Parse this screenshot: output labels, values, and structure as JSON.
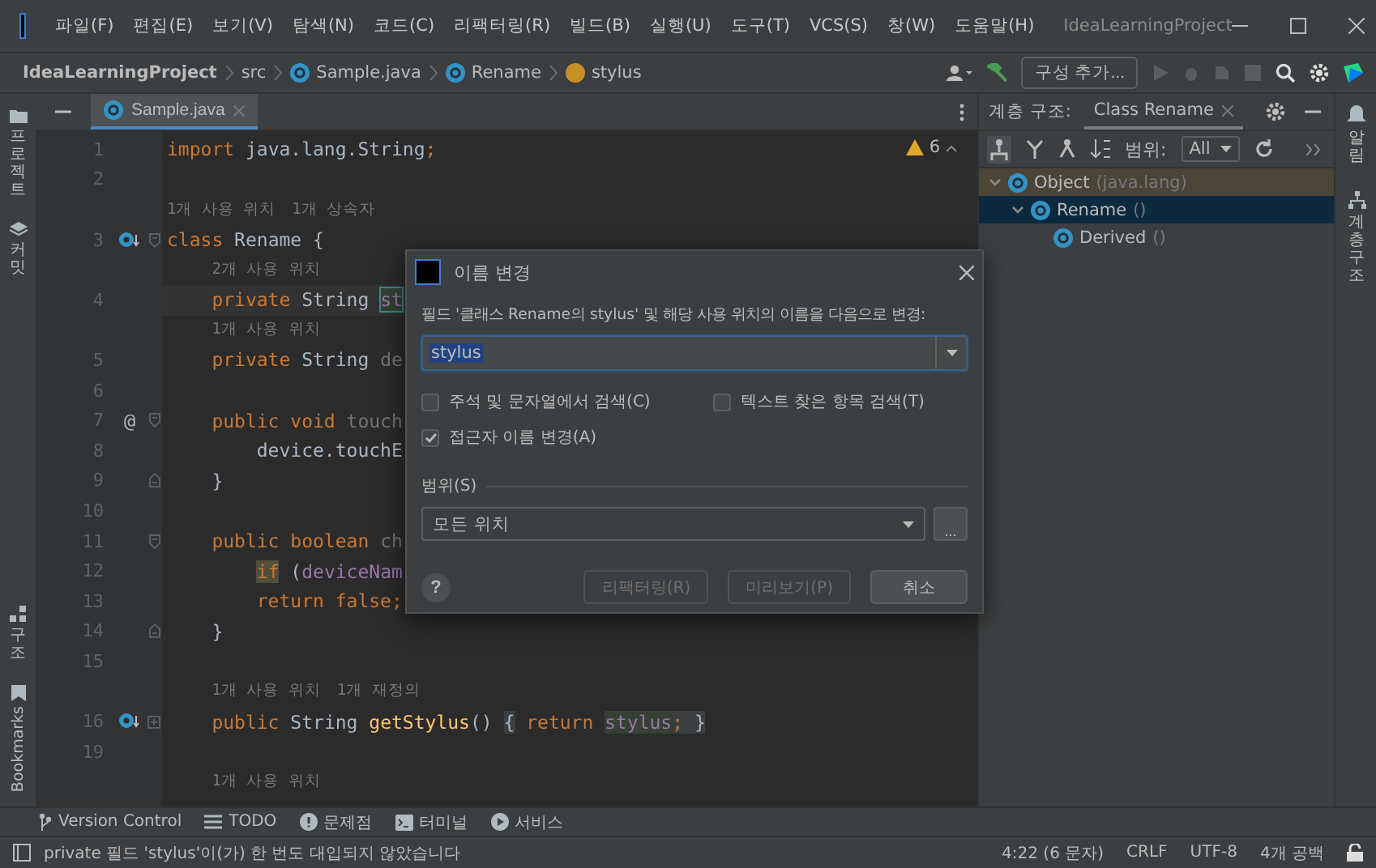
{
  "title_bar": {
    "menu": [
      "파일(F)",
      "편집(E)",
      "보기(V)",
      "탐색(N)",
      "코드(C)",
      "리팩터링(R)",
      "빌드(B)",
      "실행(U)",
      "도구(T)",
      "VCS(S)",
      "창(W)",
      "도움말(H)"
    ],
    "project": "IdeaLearningProject"
  },
  "nav_bar": {
    "breadcrumbs": [
      {
        "label": "IdeaLearningProject",
        "kind": "project"
      },
      {
        "label": "src",
        "kind": "folder"
      },
      {
        "label": "Sample.java",
        "kind": "class"
      },
      {
        "label": "Rename",
        "kind": "class"
      },
      {
        "label": "stylus",
        "kind": "field"
      }
    ],
    "run_config": "구성 추가..."
  },
  "left_strip": {
    "top": [
      {
        "label": "프로젝트",
        "kind": "folder"
      },
      {
        "label": "커밋",
        "kind": "commit"
      }
    ],
    "bottom": [
      {
        "label": "구조",
        "kind": "structure"
      },
      {
        "label": "Bookmarks",
        "kind": "bookmark"
      }
    ]
  },
  "editor": {
    "tabs": [
      {
        "label": "Sample.java",
        "selected": true
      }
    ],
    "inspection_count": "6",
    "rows": [
      {
        "kind": "code",
        "number": "1",
        "current": false,
        "tokens": [
          {
            "text": "import ",
            "kind": "keyword"
          },
          {
            "text": "java.lang.String",
            "kind": "plain"
          },
          {
            "text": ";",
            "kind": "keyword"
          }
        ]
      },
      {
        "kind": "code",
        "number": "2",
        "current": false,
        "tokens": []
      },
      {
        "kind": "hint",
        "indent": "",
        "items": [
          "1개 사용 위치",
          "1개 상속자"
        ]
      },
      {
        "kind": "code",
        "number": "3",
        "current": false,
        "gutter_icon": {
          "kind": "override"
        },
        "fold_mark": {
          "kind": "start"
        },
        "tokens": [
          {
            "text": "class ",
            "kind": "keyword"
          },
          {
            "text": "Rename {",
            "kind": "plain"
          }
        ]
      },
      {
        "kind": "hint",
        "indent": "    ",
        "items": [
          "2개 사용 위치"
        ]
      },
      {
        "kind": "code",
        "number": "4",
        "current": true,
        "tokens": [
          {
            "text": "    private ",
            "kind": "keyword"
          },
          {
            "text": "String ",
            "kind": "plain"
          },
          {
            "text": "st",
            "kind": "field",
            "highlight": {
              "kind": "usage"
            }
          }
        ]
      },
      {
        "kind": "hint",
        "indent": "    ",
        "items": [
          "1개 사용 위치"
        ]
      },
      {
        "kind": "code",
        "number": "5",
        "current": false,
        "tokens": [
          {
            "text": "    private ",
            "kind": "keyword"
          },
          {
            "text": "String ",
            "kind": "plain"
          },
          {
            "text": "de",
            "kind": "unused"
          }
        ]
      },
      {
        "kind": "code",
        "number": "6",
        "current": false,
        "tokens": []
      },
      {
        "kind": "code",
        "number": "7",
        "current": false,
        "gutter_text": "@",
        "fold_mark": {
          "kind": "start"
        },
        "tokens": [
          {
            "text": "    public void ",
            "kind": "keyword"
          },
          {
            "text": "touch",
            "kind": "unused"
          }
        ]
      },
      {
        "kind": "code",
        "number": "8",
        "current": false,
        "tokens": [
          {
            "text": "        device.touchE",
            "kind": "plain"
          }
        ]
      },
      {
        "kind": "code",
        "number": "9",
        "current": false,
        "fold_mark": {
          "kind": "end"
        },
        "tokens": [
          {
            "text": "    }",
            "kind": "plain"
          }
        ]
      },
      {
        "kind": "code",
        "number": "10",
        "current": false,
        "tokens": []
      },
      {
        "kind": "code",
        "number": "11",
        "current": false,
        "fold_mark": {
          "kind": "start"
        },
        "tokens": [
          {
            "text": "    public boolean ",
            "kind": "keyword"
          },
          {
            "text": "ch",
            "kind": "unused"
          }
        ]
      },
      {
        "kind": "code",
        "number": "12",
        "current": false,
        "indent": "        ",
        "tokens": [
          {
            "text": "if",
            "kind": "keyword",
            "highlight": {
              "kind": "warning"
            }
          },
          {
            "text": " (",
            "kind": "plain"
          },
          {
            "text": "deviceNam",
            "kind": "field"
          }
        ]
      },
      {
        "kind": "code",
        "number": "13",
        "current": false,
        "tokens": [
          {
            "text": "        return false;",
            "kind": "keyword"
          }
        ]
      },
      {
        "kind": "code",
        "number": "14",
        "current": false,
        "fold_mark": {
          "kind": "end"
        },
        "tokens": [
          {
            "text": "    }",
            "kind": "plain"
          }
        ]
      },
      {
        "kind": "code",
        "number": "15",
        "current": false,
        "tokens": []
      },
      {
        "kind": "hint",
        "indent": "    ",
        "items": [
          "1개 사용 위치",
          "1개 재정의"
        ]
      },
      {
        "kind": "code",
        "number": "16",
        "current": false,
        "gutter_icon": {
          "kind": "override"
        },
        "fold_mark": {
          "kind": "collapsed"
        },
        "tokens": [
          {
            "text": "    public ",
            "kind": "keyword"
          },
          {
            "text": "String ",
            "kind": "plain"
          },
          {
            "text": "getStylus",
            "kind": "method"
          },
          {
            "text": "() ",
            "kind": "plain"
          },
          {
            "text": "{",
            "kind": "plain",
            "highlight": {
              "kind": "brace"
            }
          },
          {
            "text": " return ",
            "kind": "keyword"
          },
          {
            "text": "stylus",
            "kind": "field",
            "highlight": {
              "kind": "write"
            }
          },
          {
            "text": "; ",
            "kind": "keyword",
            "highlight": {
              "kind": "brace"
            }
          },
          {
            "text": "}",
            "kind": "plain",
            "highlight": {
              "kind": "brace"
            }
          }
        ]
      },
      {
        "kind": "code",
        "number": "19",
        "current": false,
        "tokens": []
      },
      {
        "kind": "hint",
        "indent": "    ",
        "items": [
          "1개 사용 위치"
        ]
      }
    ]
  },
  "hierarchy": {
    "title": "계층 구조:",
    "tab": "Class Rename",
    "scope_label": "범위:",
    "scope": "All",
    "tree": [
      {
        "label": "Object",
        "detail": "(java.lang)",
        "library": true,
        "selected": false,
        "expanded": true,
        "children": [
          {
            "label": "Rename",
            "detail": "()",
            "selected": true,
            "expanded": true,
            "children": [
              {
                "label": "Derived",
                "detail": "()",
                "selected": false
              }
            ]
          }
        ]
      }
    ]
  },
  "right_strip": [
    {
      "label": "알림",
      "kind": "bell"
    },
    {
      "label": "계층 구조",
      "kind": "hierarchy"
    }
  ],
  "dialog": {
    "title": "이름 변경",
    "prompt": "필드 '클래스 Rename의 stylus' 및 해당 사용 위치의 이름을 다음으로 변경:",
    "value": "stylus",
    "options": [
      {
        "label": "주석 및 문자열에서 검색(C)",
        "checked": false
      },
      {
        "label": "텍스트 찾은 항목 검색(T)",
        "checked": false
      },
      {
        "label": "접근자 이름 변경(A)",
        "checked": true
      }
    ],
    "scope_label": "범위(S)",
    "scope": "모든 위치",
    "more": "...",
    "help": "?",
    "buttons": [
      {
        "label": "리팩터링(R)",
        "disabled": true
      },
      {
        "label": "미리보기(P)",
        "disabled": true
      },
      {
        "label": "취소",
        "disabled": false
      }
    ]
  },
  "tool_windows": [
    {
      "label": "Version Control",
      "kind": "vcs"
    },
    {
      "label": "TODO",
      "kind": "list"
    },
    {
      "label": "문제점",
      "kind": "problem"
    },
    {
      "label": "터미널",
      "kind": "terminal"
    },
    {
      "label": "서비스",
      "kind": "service"
    }
  ],
  "status_bar": {
    "message": "private 필드 'stylus'이(가) 한 번도 대입되지 않았습니다",
    "items": [
      "4:22 (6 문자)",
      "CRLF",
      "UTF-8",
      "4개 공백"
    ]
  }
}
